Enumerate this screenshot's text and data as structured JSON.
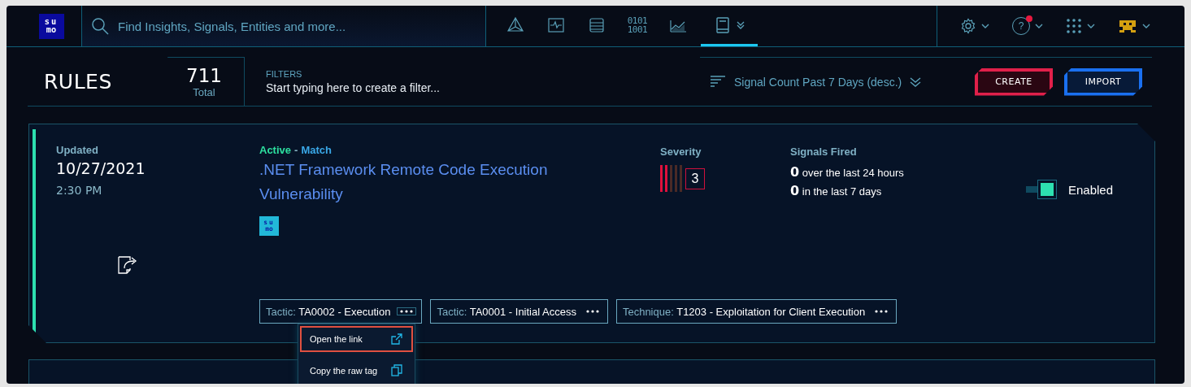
{
  "topbar": {
    "logo": {
      "top": "su",
      "bottom": "mo"
    },
    "search": {
      "placeholder": "Find Insights, Signals, Entities and more..."
    },
    "nav_tabs": [
      {
        "kind": "network",
        "selected": false
      },
      {
        "kind": "pulse",
        "selected": false
      },
      {
        "kind": "database",
        "selected": false
      },
      {
        "kind": "binary",
        "lines": [
          "0101",
          "1001"
        ],
        "selected": false
      },
      {
        "kind": "chart",
        "selected": false
      },
      {
        "kind": "book",
        "selected": true
      }
    ],
    "menus": [
      {
        "kind": "settings",
        "has_notification": false
      },
      {
        "kind": "help",
        "glyph": "?",
        "has_notification": true
      },
      {
        "kind": "apps",
        "has_notification": false
      },
      {
        "kind": "avatar",
        "has_notification": false
      }
    ]
  },
  "header": {
    "title": "RULES",
    "total": "711",
    "total_label": "Total",
    "filters": {
      "label": "FILTERS",
      "placeholder": "Start typing here to create a filter..."
    },
    "sort": "Signal Count Past 7 Days (desc.)",
    "buttons": [
      {
        "kind": "create",
        "label": "CREATE"
      },
      {
        "kind": "import",
        "label": "IMPORT"
      }
    ]
  },
  "rules": [
    {
      "updated_label": "Updated",
      "date": "10/27/2021",
      "time": "2:30 PM",
      "status": "Active",
      "separator": "-",
      "type": "Match",
      "title": ".NET Framework Remote Code Execution Vulnerability",
      "source_badge": {
        "top": "su",
        "bottom": "mo"
      },
      "severity_label": "Severity",
      "severity": "3",
      "level": 0.4,
      "signals_label": "Signals Fired",
      "signals": [
        {
          "count": "0",
          "text": "over the last 24 hours"
        },
        {
          "count": "0",
          "text": "in the last 7 days"
        }
      ],
      "enabled": true,
      "enabled_label": "Enabled",
      "tags": [
        {
          "prefix": "Tactic:",
          "value": "TA0002 - Execution",
          "menu_open": true
        },
        {
          "prefix": "Tactic:",
          "value": "TA0001 - Initial Access",
          "menu_open": false
        },
        {
          "prefix": "Technique:",
          "value": "T1203 - Exploitation for Client Execution",
          "menu_open": false
        }
      ],
      "tag_menu": [
        {
          "kind": "link",
          "label": "Open the link",
          "highlighted": true
        },
        {
          "kind": "copy",
          "label": "Copy the raw tag",
          "highlighted": false
        }
      ]
    }
  ]
}
